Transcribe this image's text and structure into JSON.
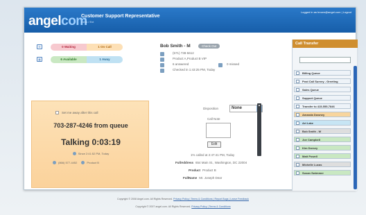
{
  "header": {
    "brand_prefix": "angel",
    "brand_suffix": "com",
    "title": "Customer Support Representative",
    "subtitle": "Desk / Ext",
    "user_links": "Logged in as brown@angel.com | Logout"
  },
  "status": {
    "row1": {
      "a": "0 Waiting",
      "b": "1 On Call"
    },
    "row2": {
      "a": "6 Available",
      "b": "1 Away"
    }
  },
  "caller": {
    "name": "Bob Smith - M",
    "check_label": "Check Out",
    "phone": "(571) 738-5612",
    "products": "Product A,Product B VIP",
    "answered": "6 answered",
    "missed": "0 missed",
    "checked_in": "Checked in 1:43:25 PM, Today"
  },
  "call_panel": {
    "checkbox_label": "Set me away after this call",
    "phone_from": "703-287-4246 from queue",
    "talking": "Talking 0:03:19",
    "time_info": "Since 2:41:52 PM, Today",
    "bottom_phone": "(866) 577-4452",
    "bottom_product": "Product B"
  },
  "disposition": {
    "label": "Disposition",
    "value": "None",
    "note_label": "Call Note",
    "edit_label": "Edit"
  },
  "details": {
    "called_line": "1% called at 2:47:41 PM, Today",
    "address_label": "FullAddress",
    "address_value": "654 Main St., Washington, DC 22004",
    "product_label": "Product",
    "product_value": "Product B",
    "fullname_label": "FullName",
    "fullname_value": "Mr. Joseph Dear"
  },
  "transfer": {
    "title": "Call Transfer",
    "items": [
      {
        "label": "Billing Queue",
        "kind": "queue"
      },
      {
        "label": "Post Call Survey - Greeting",
        "kind": "queue"
      },
      {
        "label": "Sales Queue",
        "kind": "queue"
      },
      {
        "label": "Support Queue",
        "kind": "queue"
      },
      {
        "label": "Transfer to 415-555-7846",
        "kind": "queue"
      },
      {
        "label": "Amanda Downey",
        "kind": "orange"
      },
      {
        "label": "Art Lake",
        "kind": "blue"
      },
      {
        "label": "Bob Smith - W",
        "kind": "grey"
      },
      {
        "label": "Joe Campbell",
        "kind": "green"
      },
      {
        "label": "Kim Dorsey",
        "kind": "green"
      },
      {
        "label": "Matt Powell",
        "kind": "green"
      },
      {
        "label": "Michelle Lucas",
        "kind": "grey"
      },
      {
        "label": "Susan Swimmer",
        "kind": "green"
      }
    ]
  },
  "footer": {
    "line1": "Copyright © 2008 Angel.com. All Rights Reserved.",
    "line1_links": "Privacy Policy | Terms & Conditions | Report Bugs | Leave Feedback",
    "line2": "Copyright © 2007 angel.com. All Rights Reserved.",
    "line2_links": "Privacy Policy | Terms & Conditions"
  },
  "colors": {
    "header": "#1f6bb8",
    "orange": "#cf8e2f",
    "queue": "#eef3f8",
    "green": "#c9e8c2",
    "blue": "#c7e5f4",
    "grey": "#dedede",
    "orange_item": "#f8d59d"
  }
}
